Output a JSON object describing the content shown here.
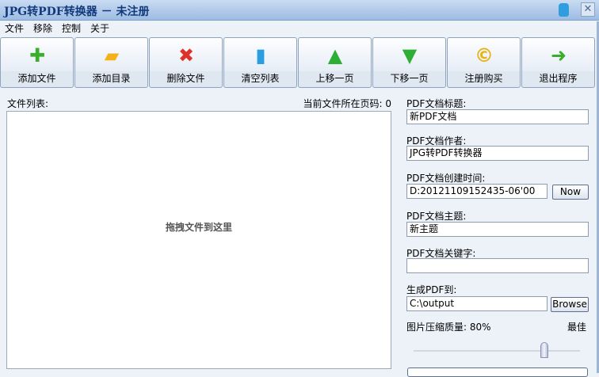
{
  "window": {
    "title": "JPG转PDF转换器 － 未注册",
    "close": "✕"
  },
  "menu": [
    "文件",
    "移除",
    "控制",
    "关于"
  ],
  "toolbar": [
    {
      "label": "添加文件",
      "icon": "plus-icon",
      "glyph": "✚",
      "color": "#3cae2c"
    },
    {
      "label": "添加目录",
      "icon": "folder-icon",
      "glyph": "▰",
      "color": "#f3b21a"
    },
    {
      "label": "删除文件",
      "icon": "delete-x-icon",
      "glyph": "✖",
      "color": "#e0302a"
    },
    {
      "label": "清空列表",
      "icon": "bin-icon",
      "glyph": "▮",
      "color": "#2b9de0"
    },
    {
      "label": "上移一页",
      "icon": "arrow-up-circle-icon",
      "glyph": "▲",
      "color": "#2fae36"
    },
    {
      "label": "下移一页",
      "icon": "arrow-down-circle-icon",
      "glyph": "▼",
      "color": "#2fae36"
    },
    {
      "label": "注册购买",
      "icon": "coin-icon",
      "glyph": "©",
      "color": "#e6b416"
    },
    {
      "label": "退出程序",
      "icon": "arrow-right-icon",
      "glyph": "➜",
      "color": "#38ae2c"
    }
  ],
  "filelist": {
    "label": "文件列表:",
    "page_label": "当前文件所在页码: 0",
    "drop_hint": "拖拽文件到这里"
  },
  "props": {
    "title_label": "PDF文档标题:",
    "title_value": "新PDF文档",
    "author_label": "PDF文档作者:",
    "author_value": "JPG转PDF转换器",
    "created_label": "PDF文档创建时间:",
    "created_value": "D:20121109152435-06'00",
    "now": "Now",
    "subject_label": "PDF文档主题:",
    "subject_value": "新主题",
    "keywords_label": "PDF文档关键字:",
    "keywords_value": "",
    "output_label": "生成PDF到:",
    "output_value": "C:\\output",
    "browse": "Browse",
    "quality_label": "图片压缩质量:  80%",
    "quality_best": "最佳",
    "quality_percent": 80
  }
}
